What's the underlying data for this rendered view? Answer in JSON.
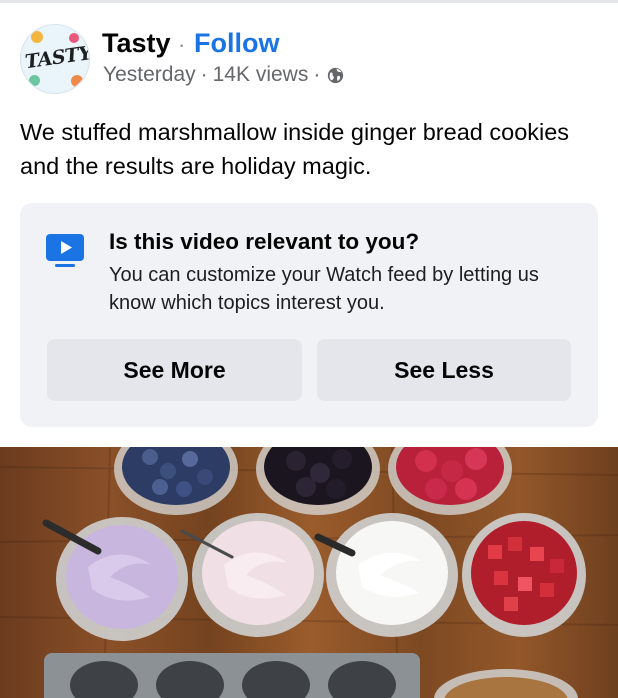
{
  "post": {
    "page_name": "Tasty",
    "name_separator": "·",
    "follow_label": "Follow",
    "timestamp": "Yesterday",
    "meta_separator": "·",
    "views": "14K views",
    "audience_icon": "globe-icon",
    "avatar_logo_text": "TASTY",
    "text": "We stuffed marshmallow inside ginger bread cookies and the results are holiday magic."
  },
  "relevance_card": {
    "icon": "watch-video-icon",
    "title": "Is this video relevant to you?",
    "description": "You can customize your Watch feed by letting us know which topics interest you.",
    "see_more_label": "See More",
    "see_less_label": "See Less"
  },
  "colors": {
    "accent": "#1b74e4",
    "secondary_text": "#65676b",
    "card_background": "#f0f2f5",
    "button_background": "#e4e6eb"
  }
}
